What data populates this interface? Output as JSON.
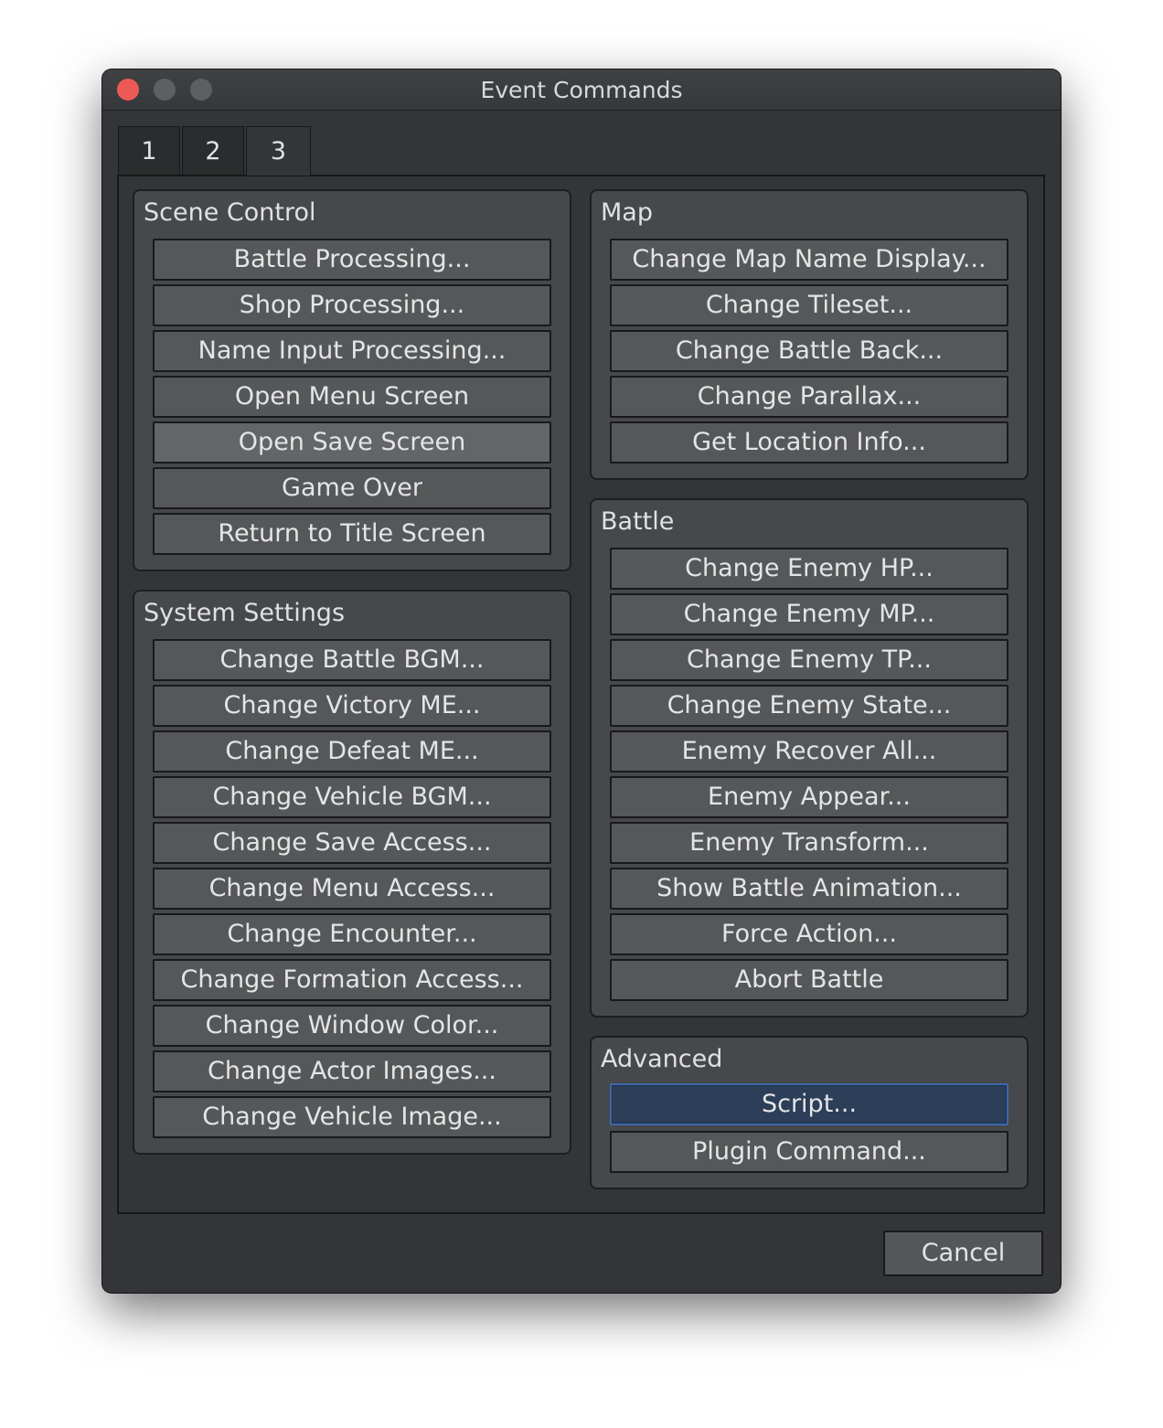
{
  "window": {
    "title": "Event Commands",
    "tabs": [
      "1",
      "2",
      "3"
    ],
    "active_tab": "3"
  },
  "scene_control": {
    "title": "Scene Control",
    "buttons": [
      "Battle Processing...",
      "Shop Processing...",
      "Name Input Processing...",
      "Open Menu Screen",
      "Open Save Screen",
      "Game Over",
      "Return to Title Screen"
    ]
  },
  "system_settings": {
    "title": "System Settings",
    "buttons": [
      "Change Battle BGM...",
      "Change Victory ME...",
      "Change Defeat ME...",
      "Change Vehicle BGM...",
      "Change Save Access...",
      "Change Menu Access...",
      "Change Encounter...",
      "Change Formation Access...",
      "Change Window Color...",
      "Change Actor Images...",
      "Change Vehicle Image..."
    ]
  },
  "map": {
    "title": "Map",
    "buttons": [
      "Change Map Name Display...",
      "Change Tileset...",
      "Change Battle Back...",
      "Change Parallax...",
      "Get Location Info..."
    ]
  },
  "battle": {
    "title": "Battle",
    "buttons": [
      "Change Enemy HP...",
      "Change Enemy MP...",
      "Change Enemy TP...",
      "Change Enemy State...",
      "Enemy Recover All...",
      "Enemy Appear...",
      "Enemy Transform...",
      "Show Battle Animation...",
      "Force Action...",
      "Abort Battle"
    ]
  },
  "advanced": {
    "title": "Advanced",
    "buttons": [
      "Script...",
      "Plugin Command..."
    ]
  },
  "footer": {
    "cancel_label": "Cancel"
  },
  "colors": {
    "close": "#ed5a55",
    "selection_border": "#3d69a8",
    "selection_fill": "#2c3e58"
  }
}
